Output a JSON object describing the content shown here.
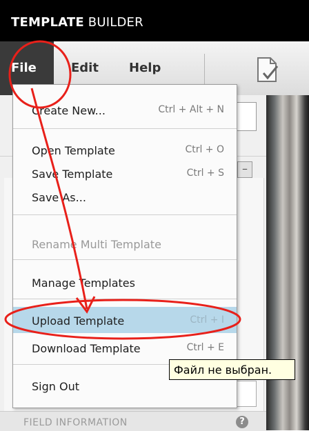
{
  "app": {
    "title_bold": "TEMPLATE",
    "title_light": "BUILDER"
  },
  "menubar": {
    "file": "File",
    "edit": "Edit",
    "help": "Help",
    "doc_icon": "document-check-icon"
  },
  "file_menu": {
    "items": [
      {
        "label": "Create New...",
        "shortcut": "Ctrl + Alt + N"
      },
      {
        "label": "Open Template",
        "shortcut": "Ctrl + O"
      },
      {
        "label": "Save Template",
        "shortcut": "Ctrl + S"
      },
      {
        "label": "Save As...",
        "shortcut": ""
      },
      {
        "label": "Rename Multi Template",
        "shortcut": "",
        "disabled": true
      },
      {
        "label": "Manage Templates",
        "shortcut": ""
      },
      {
        "label": "Upload Template",
        "shortcut": "Ctrl + I",
        "highlighted": true
      },
      {
        "label": "Download Template",
        "shortcut": "Ctrl + E"
      },
      {
        "label": "Sign Out",
        "shortcut": ""
      }
    ]
  },
  "tooltip": "Файл не выбран.",
  "panel": {
    "field_information": "FIELD INFORMATION",
    "help_icon_glyph": "?",
    "minus_glyph": "–"
  },
  "colors": {
    "annotation_red": "#e8201a",
    "highlight": "#b7d8ea"
  }
}
